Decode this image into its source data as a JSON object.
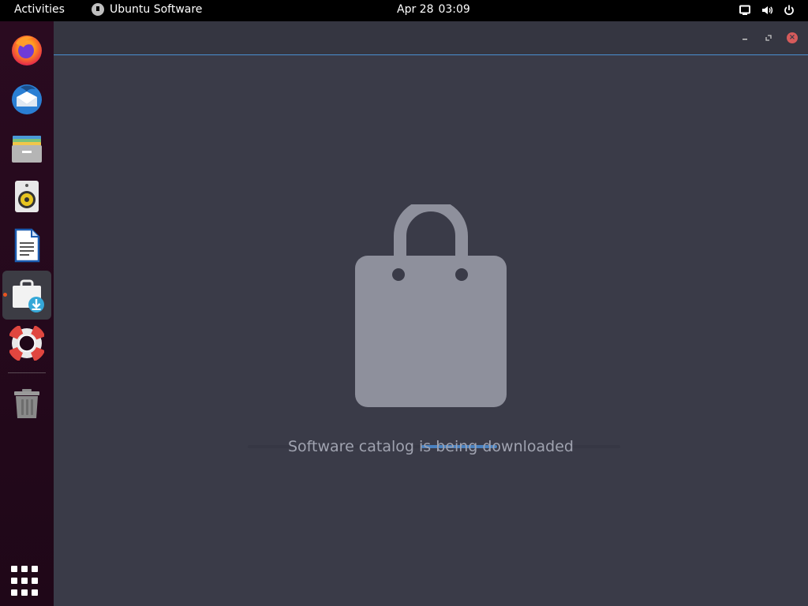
{
  "topbar": {
    "activities_label": "Activities",
    "app_menu_label": "Ubuntu Software",
    "date": "Apr 28",
    "time": "03:09"
  },
  "dock": {
    "items": [
      {
        "name": "Firefox",
        "icon": "firefox-icon"
      },
      {
        "name": "Thunderbird",
        "icon": "thunderbird-icon"
      },
      {
        "name": "Files",
        "icon": "files-icon"
      },
      {
        "name": "Rhythmbox",
        "icon": "rhythmbox-icon"
      },
      {
        "name": "LibreOffice Writer",
        "icon": "writer-icon"
      },
      {
        "name": "Ubuntu Software",
        "icon": "software-icon",
        "active": true
      },
      {
        "name": "Help",
        "icon": "help-icon"
      },
      {
        "name": "Trash",
        "icon": "trash-icon"
      }
    ],
    "show_apps_icon": "grid-icon"
  },
  "window": {
    "status_text": "Software catalog is being downloaded",
    "progress_indeterminate": true
  },
  "colors": {
    "accent": "#4a82c0",
    "running_indicator": "#e95420",
    "close_button": "#d65b5b",
    "window_bg": "#3a3b48",
    "bag_color": "#8e909c"
  }
}
